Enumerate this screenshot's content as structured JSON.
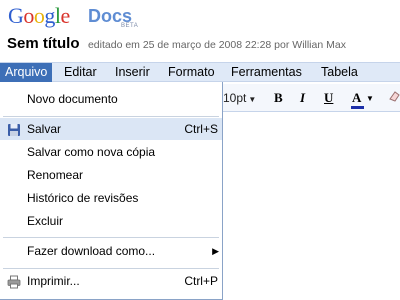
{
  "brand": {
    "logo_letters": [
      "G",
      "o",
      "o",
      "g",
      "l",
      "e"
    ],
    "product": "Docs",
    "beta": "BETA"
  },
  "document": {
    "title": "Sem título",
    "edited_info": "editado em 25 de março de 2008 22:28 por Willian Max"
  },
  "menubar": {
    "items": [
      "Arquivo",
      "Editar",
      "Inserir",
      "Formato",
      "Ferramentas",
      "Tabela"
    ],
    "active": "Arquivo"
  },
  "toolbar": {
    "font_size": "10pt",
    "bold": "B",
    "italic": "I",
    "underline": "U",
    "text_color": "A"
  },
  "file_menu": {
    "new_document": "Novo documento",
    "save": "Salvar",
    "save_shortcut": "Ctrl+S",
    "save_as_copy": "Salvar como nova cópia",
    "rename": "Renomear",
    "revision_history": "Histórico de revisões",
    "delete": "Excluir",
    "download_as": "Fazer download como...",
    "print": "Imprimir...",
    "print_shortcut": "Ctrl+P"
  },
  "colors": {
    "menubar_bg": "#dfe9f7",
    "menu_active": "#3d6fb7",
    "hover_bg": "#dbe6f5",
    "docs_blue": "#5f8dd3"
  },
  "icons": [
    "save-floppy-icon",
    "printer-icon",
    "submenu-arrow-icon",
    "dropdown-arrow-icon",
    "eraser-icon"
  ]
}
